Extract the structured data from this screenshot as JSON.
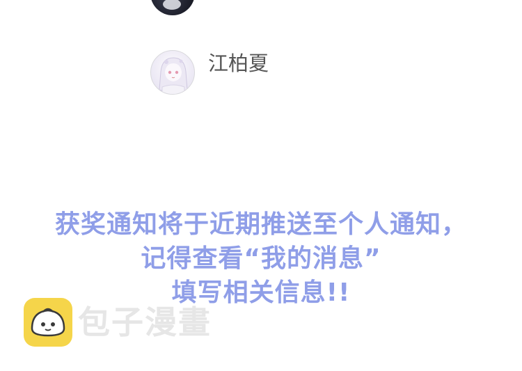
{
  "comment": {
    "username": "江柏夏"
  },
  "notice": {
    "line1": "获奖通知将于近期推送至个人通知，",
    "line2": "记得查看“我的消息”",
    "line3": "填写相关信息!!"
  },
  "watermark": {
    "brand_text": "包子漫畫",
    "logo_icon": "baozi-bun-icon"
  },
  "colors": {
    "notice_text": "#8f9ee8",
    "username_text": "#555555",
    "logo_bg": "#f5d54a",
    "watermark_text": "#e6e6e6"
  }
}
